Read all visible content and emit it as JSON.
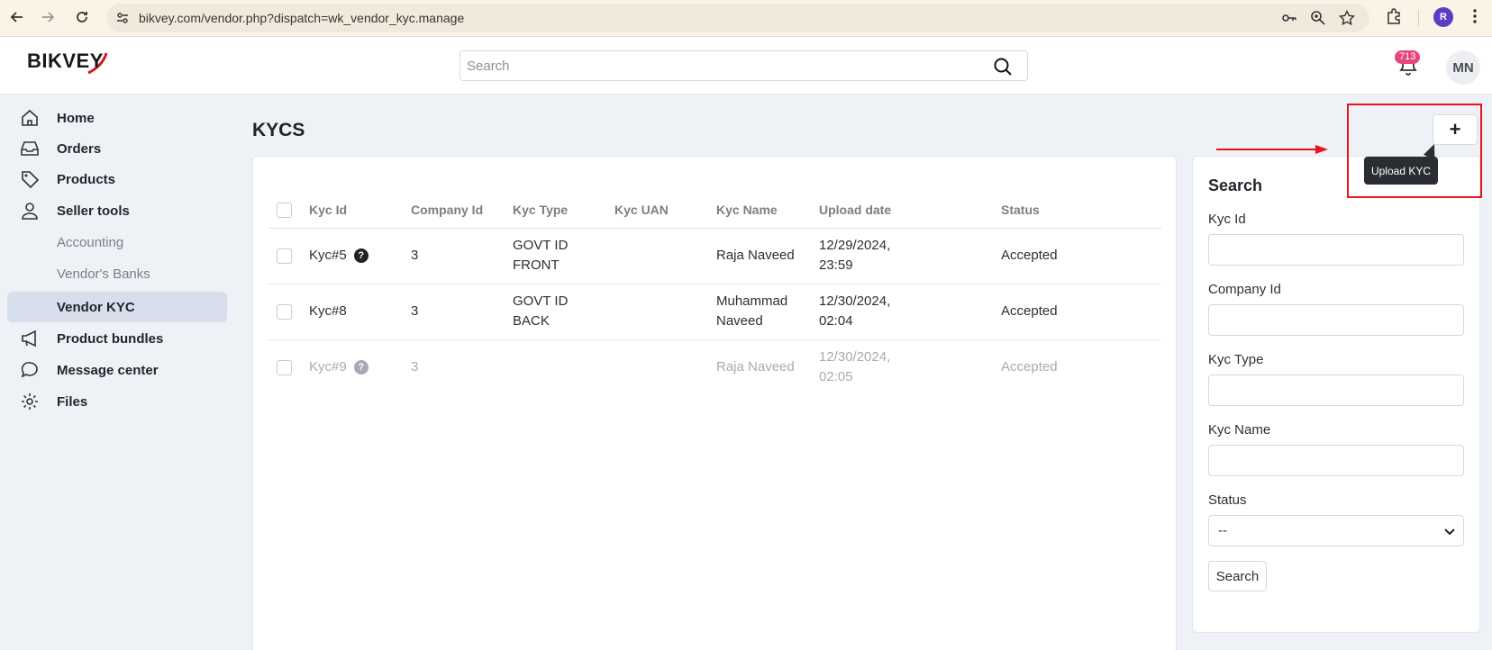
{
  "browser": {
    "url": "bikvey.com/vendor.php?dispatch=wk_vendor_kyc.manage",
    "profile_initial": "R"
  },
  "header": {
    "logo_text": "BIKVEY",
    "search_placeholder": "Search",
    "notifications_count": "713",
    "avatar_initials": "MN"
  },
  "sidebar": {
    "items": [
      {
        "label": "Home",
        "icon": "home-icon"
      },
      {
        "label": "Orders",
        "icon": "inbox-icon"
      },
      {
        "label": "Products",
        "icon": "tag-icon"
      },
      {
        "label": "Seller tools",
        "icon": "user-icon"
      },
      {
        "label": "Accounting"
      },
      {
        "label": "Vendor's Banks"
      },
      {
        "label": "Vendor KYC"
      },
      {
        "label": "Product bundles",
        "icon": "megaphone-icon"
      },
      {
        "label": "Message center",
        "icon": "chat-icon"
      },
      {
        "label": "Files",
        "icon": "gear-icon"
      }
    ],
    "active_item": "Vendor KYC"
  },
  "main": {
    "title": "KYCS",
    "columns": [
      "Kyc Id",
      "Company Id",
      "Kyc Type",
      "Kyc UAN",
      "Kyc Name",
      "Upload date",
      "Status"
    ],
    "rows": [
      {
        "kyc_id": "Kyc#5",
        "company_id": "3",
        "kyc_type_1": "GOVT ID",
        "kyc_type_2": "FRONT",
        "kyc_uan": "",
        "kyc_name_1": "Raja Naveed",
        "kyc_name_2": "",
        "date_1": "12/29/2024,",
        "date_2": "23:59",
        "status": "Accepted"
      },
      {
        "kyc_id": "Kyc#8",
        "company_id": "3",
        "kyc_type_1": "GOVT ID",
        "kyc_type_2": "BACK",
        "kyc_uan": "",
        "kyc_name_1": "Muhammad",
        "kyc_name_2": "Naveed",
        "date_1": "12/30/2024,",
        "date_2": "02:04",
        "status": "Accepted"
      },
      {
        "kyc_id": "Kyc#9",
        "company_id": "3",
        "kyc_type_1": "",
        "kyc_type_2": "",
        "kyc_uan": "",
        "kyc_name_1": "Raja Naveed",
        "kyc_name_2": "",
        "date_1": "12/30/2024,",
        "date_2": "02:05",
        "status": "Accepted"
      }
    ],
    "help_glyph": "?"
  },
  "actions": {
    "add_label": "+",
    "tooltip": "Upload KYC"
  },
  "filter": {
    "title": "Search",
    "labels": {
      "kyc_id": "Kyc Id",
      "company_id": "Company Id",
      "kyc_type": "Kyc Type",
      "kyc_name": "Kyc Name",
      "status": "Status"
    },
    "status_selected": "--",
    "search_button": "Search"
  },
  "colors": {
    "annotation_red": "#e8141c",
    "badge_pink": "#e8457c",
    "active_nav": "#d6dfeb"
  }
}
